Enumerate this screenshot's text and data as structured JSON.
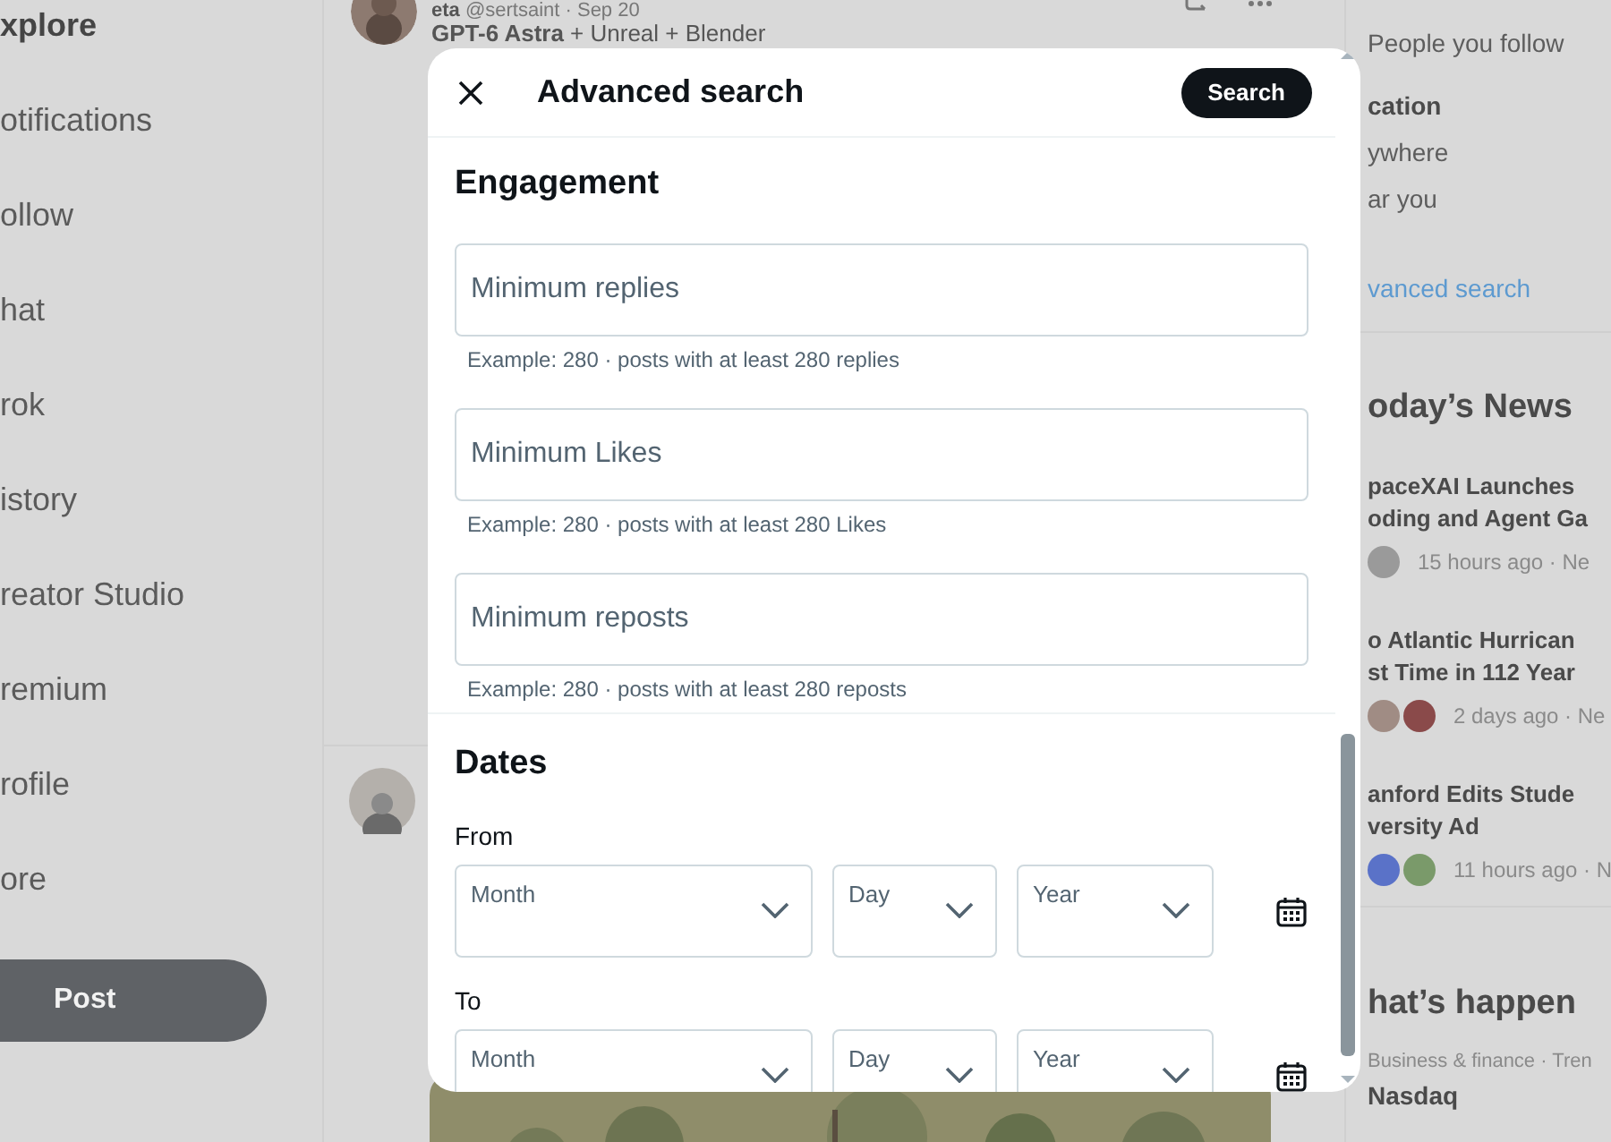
{
  "nav": {
    "items": [
      {
        "label": "xplore",
        "selected": true
      },
      {
        "label": "otifications",
        "selected": false
      },
      {
        "label": "ollow",
        "selected": false
      },
      {
        "label": "hat",
        "selected": false
      },
      {
        "label": "rok",
        "selected": false
      },
      {
        "label": "istory",
        "selected": false
      },
      {
        "label": "reator Studio",
        "selected": false
      },
      {
        "label": "remium",
        "selected": false
      },
      {
        "label": "rofile",
        "selected": false
      },
      {
        "label": "ore",
        "selected": false
      }
    ],
    "post_button": "Post"
  },
  "feed": {
    "posts": [
      {
        "kind": "text",
        "author": "eta",
        "handle": "@sertsaint · Sep 20",
        "text": "**GPT-6 Astra** + Unreal + Blender"
      },
      {
        "kind": "media"
      }
    ]
  },
  "search_options": {
    "rows": [
      {
        "kind": "option",
        "text": "People you follow"
      },
      {
        "kind": "heading",
        "text": "cation"
      },
      {
        "kind": "option",
        "text": "ywhere"
      },
      {
        "kind": "option",
        "text": "ar you"
      },
      {
        "kind": "link",
        "text": "vanced search"
      }
    ]
  },
  "news": {
    "title": "oday’s News",
    "stories": [
      {
        "headline": [
          "paceXAI Launches",
          "oding and Agent Ga"
        ],
        "meta": "15 hours ago · Ne",
        "avatars": [
          {
            "color": "#9a9a9a"
          }
        ]
      },
      {
        "headline": [
          "o Atlantic Hurrican",
          "st Time in 112 Year"
        ],
        "meta": "2 days ago · Ne",
        "avatars": [
          {
            "color": "#a08c84"
          },
          {
            "color": "#8a4a4a"
          }
        ]
      },
      {
        "headline": [
          "anford Edits Stude",
          "versity Ad"
        ],
        "meta": "11 hours ago · N",
        "avatars": [
          {
            "color": "#5a72c8"
          },
          {
            "color": "#7a9a6a"
          }
        ]
      }
    ]
  },
  "trending": {
    "title": "hat’s happen",
    "items": [
      {
        "context": "Business & finance · Tren",
        "name": "Nasdaq"
      }
    ]
  },
  "modal": {
    "title": "Advanced search",
    "search_button": "Search",
    "sections": [
      {
        "kind": "engagement",
        "title": "Engagement",
        "fields": [
          {
            "placeholder": "Minimum replies",
            "hint": "Example: 280 · posts with at least 280 replies"
          },
          {
            "placeholder": "Minimum Likes",
            "hint": "Example: 280 · posts with at least 280 Likes"
          },
          {
            "placeholder": "Minimum reposts",
            "hint": "Example: 280 · posts with at least 280 reposts"
          }
        ]
      },
      {
        "kind": "dates",
        "title": "Dates",
        "ranges": [
          {
            "label": "From",
            "selects": [
              "Month",
              "Day",
              "Year"
            ]
          },
          {
            "label": "To",
            "selects": [
              "Month",
              "Day",
              "Year"
            ]
          }
        ]
      }
    ]
  }
}
